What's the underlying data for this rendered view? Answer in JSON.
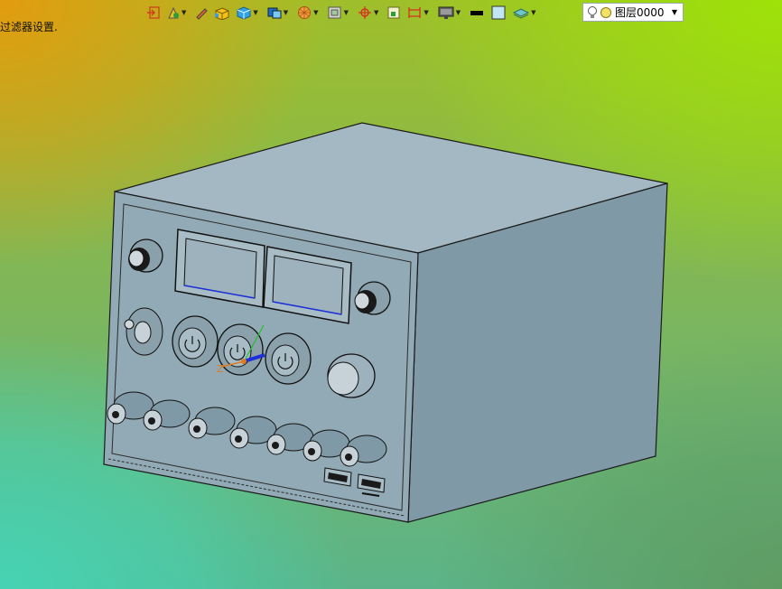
{
  "status": {
    "message": "过滤器设置."
  },
  "toolbar": {
    "icons": [
      "exit-icon",
      "paint-icon",
      "pencil-icon",
      "solid-box-icon",
      "view-cube-icon",
      "display-mode-icon",
      "section-view-icon",
      "frame-view-icon",
      "snap-point-icon",
      "fit-view-icon",
      "dimension-icon",
      "monitor-icon",
      "line-color-swatch",
      "fill-color-swatch",
      "layer-visibility-icon"
    ],
    "layer": {
      "label": "图层0000"
    }
  },
  "colors": {
    "model_body": "#7f99a6",
    "model_top": "#a3b8c2",
    "model_front": "#91aab6",
    "triad_x": "#e07a1a",
    "triad_y": "#22c02a",
    "triad_z": "#1c2fd8"
  }
}
